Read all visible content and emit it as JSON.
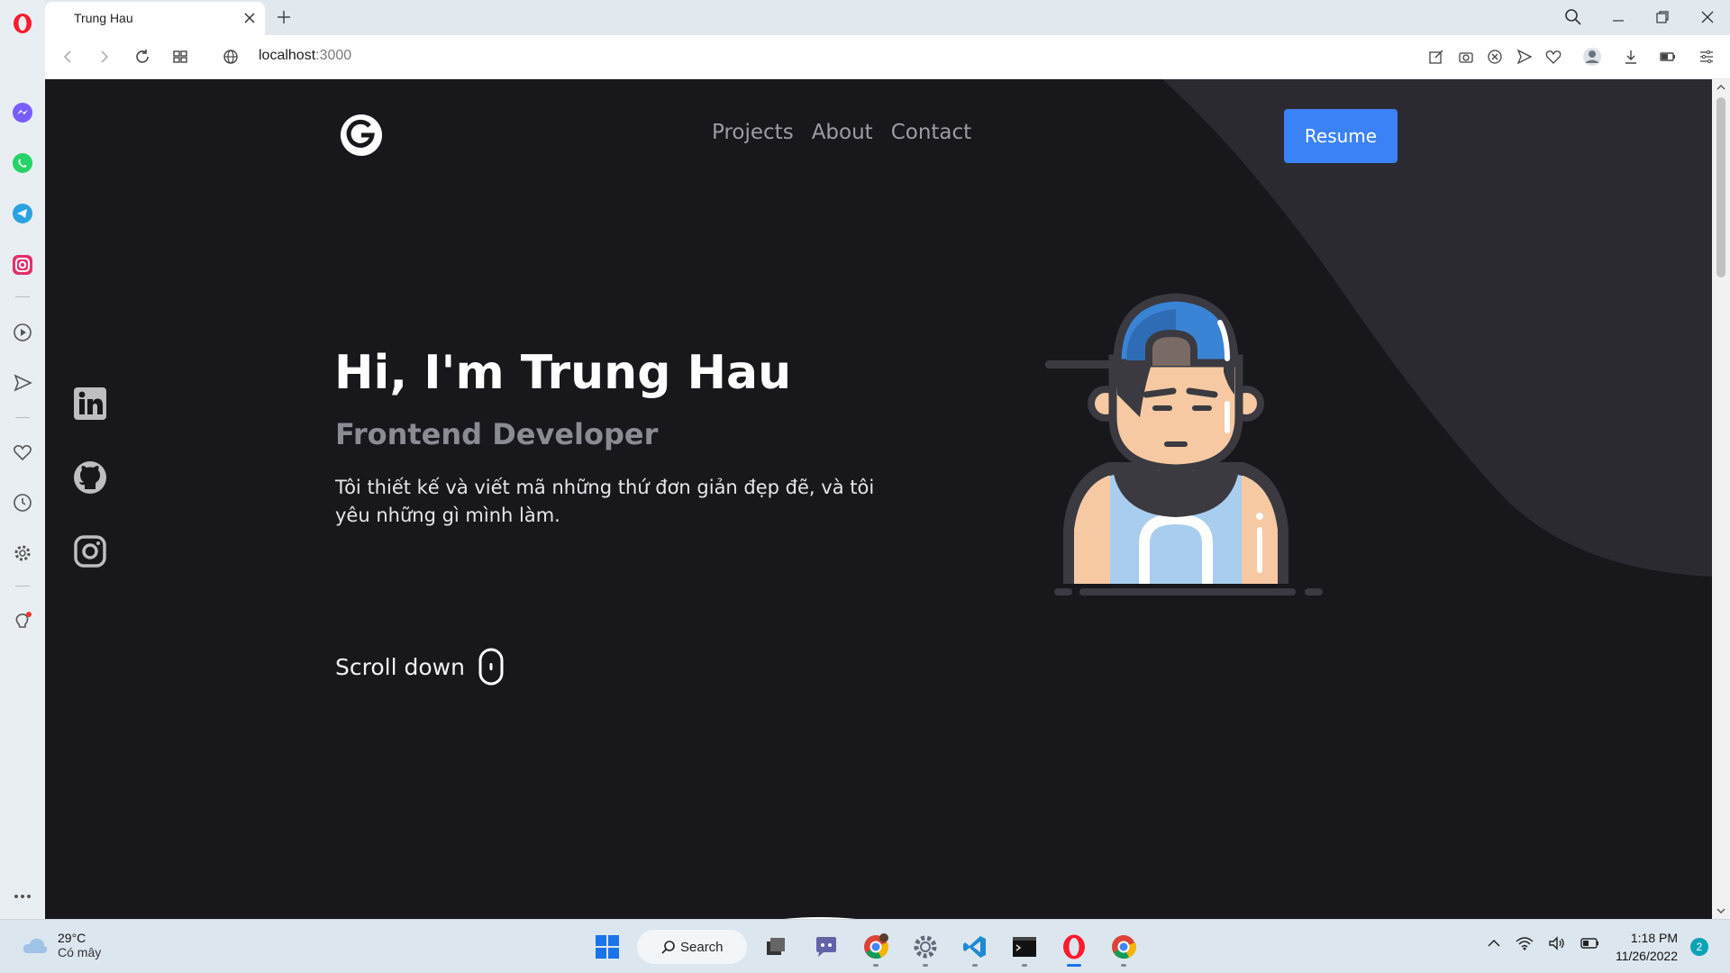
{
  "browser": {
    "tab_title": "Trung Hau",
    "url_host": "localhost",
    "url_port": ":3000"
  },
  "site": {
    "nav": [
      "Projects",
      "About",
      "Contact"
    ],
    "resume_label": "Resume",
    "hero_title": "Hi, I'm Trung Hau",
    "hero_subtitle": "Frontend Developer",
    "hero_description": "Tôi thiết kế và viết mã những thứ đơn giản đẹp đẽ, và tôi yêu những gì mình làm.",
    "scroll_down_label": "Scroll down",
    "socials": [
      "linkedin-icon",
      "github-icon",
      "instagram-icon"
    ],
    "colors": {
      "background": "#18171c",
      "accent": "#3b82f6",
      "muted": "#8b8b93"
    }
  },
  "taskbar": {
    "weather_temp": "29°C",
    "weather_cond": "Có mây",
    "search_label": "Search",
    "time": "1:18 PM",
    "date": "11/26/2022",
    "notifications": "2"
  }
}
